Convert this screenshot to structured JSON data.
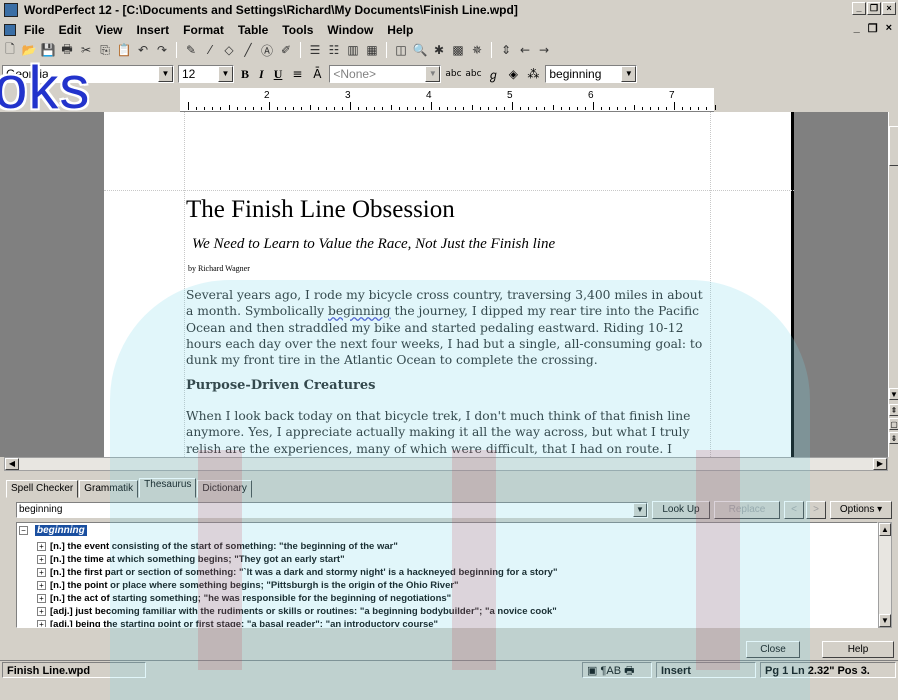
{
  "window": {
    "title": "WordPerfect 12 - [C:\\Documents and Settings\\Richard\\My Documents\\Finish Line.wpd]"
  },
  "menubar": {
    "items": [
      "File",
      "Edit",
      "View",
      "Insert",
      "Format",
      "Table",
      "Tools",
      "Window",
      "Help"
    ]
  },
  "format_toolbar": {
    "font": "Georgia",
    "font_size": "12",
    "style": "<None>",
    "search": "beginning"
  },
  "watermark_text": "oks",
  "ruler": {
    "numbers": [
      "2",
      "3",
      "4",
      "5",
      "6",
      "7"
    ]
  },
  "document": {
    "title": "The Finish Line Obsession",
    "subtitle": "We Need to Learn to Value the Race, Not Just the Finish line",
    "byline": "by Richard Wagner",
    "paragraph1_before": "Several years ago, I rode my bicycle cross country, traversing 3,400 miles in about a month. Symbolically ",
    "paragraph1_word": "beginning",
    "paragraph1_after": " the journey, I dipped my rear tire into the Pacific Ocean and then straddled my bike and started pedaling eastward. Riding 10-12 hours each day over the next four weeks, I had but a single, all-consuming goal: to dunk my front tire in the Atlantic Ocean to complete the crossing.",
    "heading": "Purpose-Driven Creatures",
    "paragraph2": "When I look back today on that bicycle trek, I don't much think of that finish line anymore. Yes, I appreciate actually making it all the way across, but what I truly relish are the experiences, many of which were difficult, that I had on route. I recall that"
  },
  "thesaurus": {
    "tabs": [
      "Spell Checker",
      "Grammatik",
      "Thesaurus",
      "Dictionary"
    ],
    "active_tab": "Thesaurus",
    "word": "beginning",
    "buttons": {
      "look_up": "Look Up",
      "replace": "Replace",
      "back": "<",
      "forward": ">",
      "options": "Options"
    },
    "root": "beginning",
    "definitions": [
      "[n.] the event consisting of the start of something: \"the beginning of the war\"",
      "[n.] the time at which something begins; \"They got an early start\"",
      "[n.] the first part or section of something: \"`It was a dark and stormy night' is a hackneyed beginning for a story\"",
      "[n.] the point or place where something begins; \"Pittsburgh is the origin of the Ohio River\"",
      "[n.] the act of starting something; \"he was responsible for the beginning of negotiations\"",
      "[adj.] just becoming familiar with the rudiments or skills or routines: \"a beginning bodybuilder\"; \"a novice cook\"",
      "[adj.] being the starting point or first stage; \"a basal reader\"; \"an introductory course\""
    ],
    "close": "Close",
    "help": "Help"
  },
  "statusbar": {
    "filename": "Finish Line.wpd",
    "mode": "Insert",
    "position": "Pg 1 Ln 2.32\" Pos 3."
  }
}
